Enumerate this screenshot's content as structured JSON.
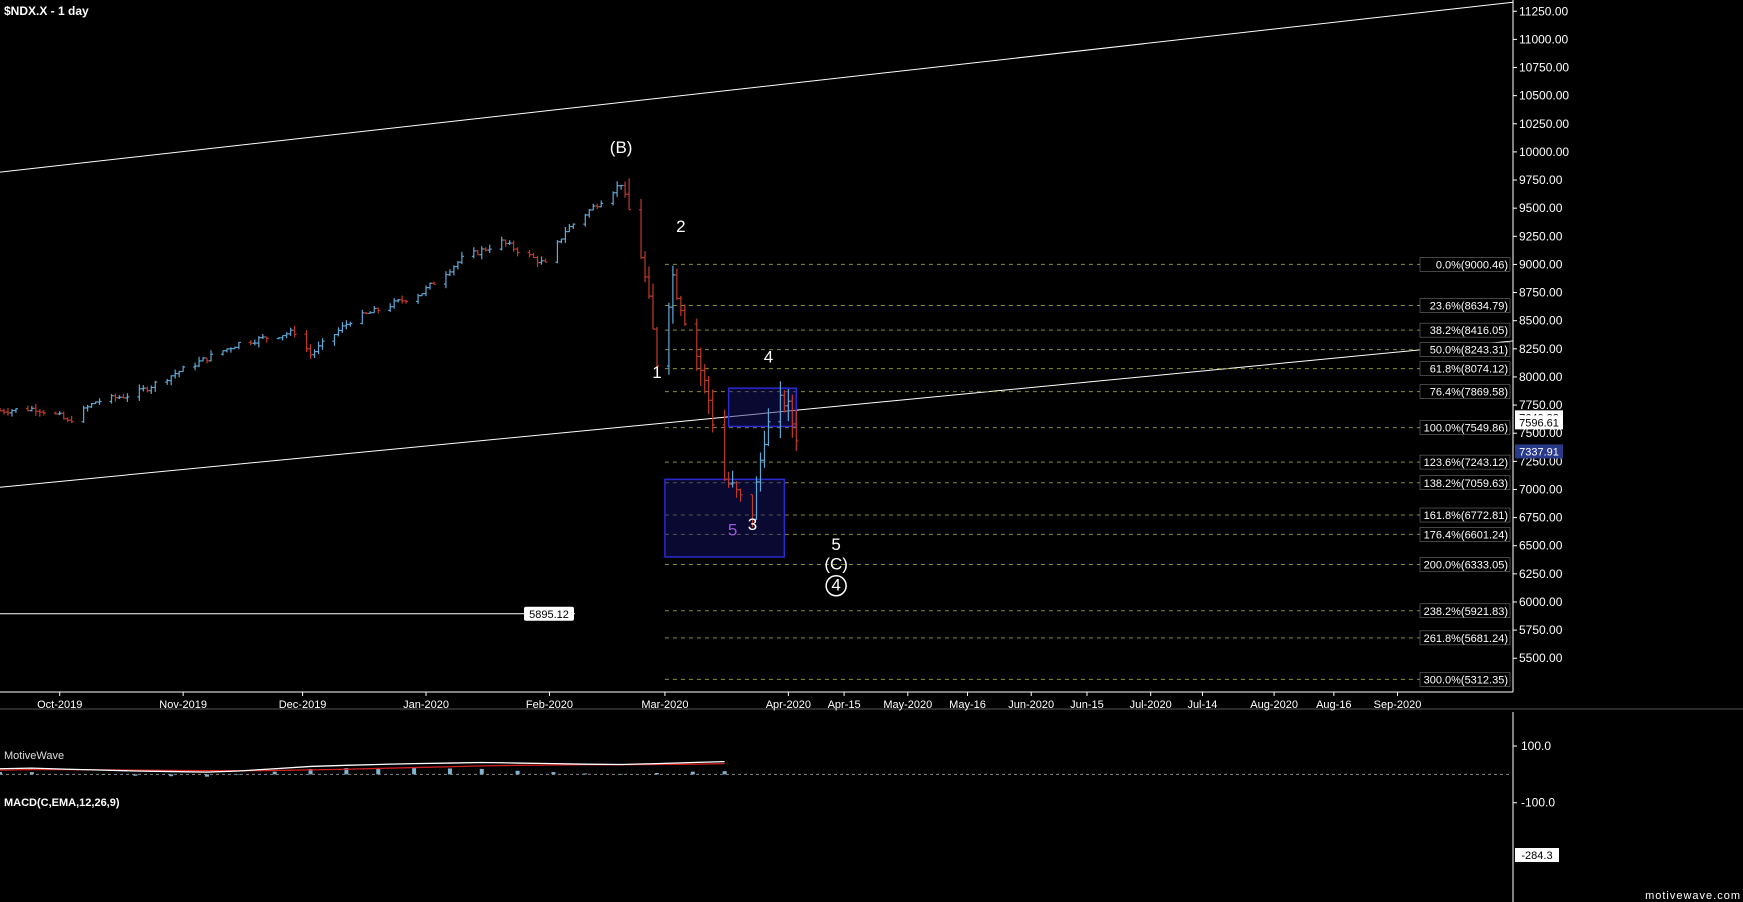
{
  "window": {
    "title": "$NDX.X - 1 day",
    "brand": "MotiveWave",
    "site": "motivewave.com"
  },
  "colors": {
    "bg": "#000000",
    "up": "#5fa8d6",
    "down": "#c0392b",
    "channel": "#ffffff",
    "fib": "#8a8a3a",
    "box": "#1a1a9a",
    "axis": "#ffffff"
  },
  "chart_data": {
    "type": "ohlc",
    "title": "$NDX.X - 1 day",
    "ylim": [
      5200,
      11350
    ],
    "y_ticks": [
      "5500.00",
      "5750.00",
      "6000.00",
      "6250.00",
      "6500.00",
      "6750.00",
      "7000.00",
      "7250.00",
      "7500.00",
      "7750.00",
      "8000.00",
      "8250.00",
      "8500.00",
      "8750.00",
      "9000.00",
      "9250.00",
      "9500.00",
      "9750.00",
      "10000.00",
      "10250.00",
      "10500.00",
      "10750.00",
      "11000.00",
      "11250.00"
    ],
    "x_ticks": [
      "Oct-2019",
      "Nov-2019",
      "Dec-2019",
      "Jan-2020",
      "Feb-2020",
      "Mar-2020",
      "Apr-2020",
      "Apr-15",
      "May-2020",
      "May-16",
      "Jun-2020",
      "Jun-15",
      "Jul-2020",
      "Jul-14",
      "Aug-2020",
      "Aug-16",
      "Sep-2020"
    ],
    "price_path": [
      [
        "2019-09-16",
        7700
      ],
      [
        "2019-09-25",
        7720
      ],
      [
        "2019-10-01",
        7650
      ],
      [
        "2019-10-03",
        7600
      ],
      [
        "2019-10-10",
        7780
      ],
      [
        "2019-10-20",
        7850
      ],
      [
        "2019-10-31",
        8050
      ],
      [
        "2019-11-15",
        8300
      ],
      [
        "2019-11-29",
        8400
      ],
      [
        "2019-12-03",
        8200
      ],
      [
        "2019-12-13",
        8500
      ],
      [
        "2019-12-31",
        8750
      ],
      [
        "2020-01-10",
        9050
      ],
      [
        "2020-01-20",
        9200
      ],
      [
        "2020-01-31",
        9000
      ],
      [
        "2020-02-05",
        9300
      ],
      [
        "2020-02-19",
        9720
      ],
      [
        "2020-02-24",
        9100
      ],
      [
        "2020-02-28",
        8150
      ],
      [
        "2020-03-03",
        8900
      ],
      [
        "2020-03-09",
        8200
      ],
      [
        "2020-03-12",
        7800
      ],
      [
        "2020-03-16",
        7100
      ],
      [
        "2020-03-20",
        6900
      ],
      [
        "2020-03-23",
        6780
      ],
      [
        "2020-03-26",
        7500
      ],
      [
        "2020-03-31",
        7800
      ],
      [
        "2020-04-02",
        7600
      ],
      [
        "2020-04-03",
        7500
      ]
    ],
    "fib_levels": [
      {
        "label": "0.0%(9000.46)",
        "value": 9000.46
      },
      {
        "label": "23.6%(8634.79)",
        "value": 8634.79
      },
      {
        "label": "38.2%(8416.05)",
        "value": 8416.05
      },
      {
        "label": "50.0%(8243.31)",
        "value": 8243.31
      },
      {
        "label": "61.8%(8074.12)",
        "value": 8074.12
      },
      {
        "label": "76.4%(7869.58)",
        "value": 7869.58
      },
      {
        "label": "100.0%(7549.86)",
        "value": 7549.86
      },
      {
        "label": "123.6%(7243.12)",
        "value": 7243.12
      },
      {
        "label": "138.2%(7059.63)",
        "value": 7059.63
      },
      {
        "label": "161.8%(6772.81)",
        "value": 6772.81
      },
      {
        "label": "176.4%(6601.24)",
        "value": 6601.24
      },
      {
        "label": "200.0%(6333.05)",
        "value": 6333.05
      },
      {
        "label": "238.2%(5921.83)",
        "value": 5921.83
      },
      {
        "label": "261.8%(5681.24)",
        "value": 5681.24
      },
      {
        "label": "300.0%(5312.35)",
        "value": 5312.35
      }
    ],
    "price_tags": [
      {
        "label": "7640.82",
        "value": 7640.82
      },
      {
        "label": "7596.61",
        "value": 7596.61
      },
      {
        "label": "7337.91",
        "value": 7337.91,
        "highlight": true
      }
    ],
    "horizontal_line": {
      "label": "5895.12",
      "value": 5895.12
    },
    "channel": {
      "upper": [
        [
          "2019-09-16",
          9820
        ],
        [
          "2020-09-30",
          11330
        ]
      ],
      "lower": [
        [
          "2019-09-16",
          7020
        ],
        [
          "2020-09-30",
          8320
        ]
      ]
    },
    "zones": [
      {
        "from": "2020-03-17",
        "to": "2020-04-03",
        "high": 7900,
        "low": 7560
      },
      {
        "from": "2020-03-01",
        "to": "2020-03-31",
        "high": 7090,
        "low": 6400
      }
    ],
    "wave_labels": [
      {
        "text": "(B)",
        "date": "2020-02-19",
        "value": 9990,
        "color": "#ffffff"
      },
      {
        "text": "2",
        "date": "2020-03-05",
        "value": 9290,
        "color": "#ffffff"
      },
      {
        "text": "1",
        "date": "2020-02-28",
        "value": 7990,
        "color": "#ffffff"
      },
      {
        "text": "4",
        "date": "2020-03-27",
        "value": 8130,
        "color": "#ffffff"
      },
      {
        "text": "3",
        "date": "2020-03-23",
        "value": 6640,
        "color": "#ffffff"
      },
      {
        "text": "5",
        "date": "2020-03-18",
        "value": 6590,
        "color": "#9b59d6"
      },
      {
        "text": "5",
        "date": "2020-04-13",
        "value": 6460,
        "color": "#ffffff"
      },
      {
        "text": "(C)",
        "date": "2020-04-13",
        "value": 6290,
        "color": "#ffffff"
      },
      {
        "text": "4",
        "date": "2020-04-13",
        "value": 6100,
        "color": "#ffffff",
        "circled": true
      }
    ]
  },
  "macd": {
    "title": "MACD(C,EMA,12,26,9)",
    "y_ticks": [
      "100.0",
      "-100.0"
    ],
    "tag": "-284.3",
    "ylim": [
      -450,
      220
    ],
    "dates_start": "2019-09-16",
    "macd": [
      20,
      22,
      18,
      15,
      12,
      10,
      8,
      12,
      20,
      28,
      32,
      35,
      38,
      40,
      42,
      40,
      38,
      36,
      35,
      38,
      42,
      45,
      48,
      50,
      55,
      58,
      60,
      62,
      63,
      64,
      65,
      66,
      68,
      70,
      72,
      74,
      75,
      78,
      80,
      82,
      85,
      88,
      90,
      92,
      95,
      96,
      95,
      90,
      80,
      60,
      30,
      -20,
      -90,
      -140,
      -170,
      -190,
      -210,
      -240,
      -270,
      -300,
      -320,
      -340,
      -330,
      -310,
      -290,
      -270,
      -250,
      -220,
      -200,
      -180
    ],
    "signal": [
      15,
      17,
      17,
      16,
      15,
      14,
      13,
      13,
      14,
      16,
      18,
      21,
      24,
      27,
      30,
      32,
      33,
      34,
      34,
      35,
      36,
      38,
      40,
      42,
      44,
      46,
      48,
      50,
      52,
      54,
      56,
      58,
      60,
      62,
      64,
      66,
      68,
      70,
      72,
      74,
      76,
      78,
      80,
      82,
      84,
      86,
      88,
      88,
      86,
      82,
      74,
      62,
      45,
      25,
      5,
      -20,
      -45,
      -70,
      -100,
      -130,
      -160,
      -190,
      -210,
      -225,
      -240,
      -250,
      -255,
      -255,
      -250,
      -240
    ],
    "hist_step_days": 3
  }
}
